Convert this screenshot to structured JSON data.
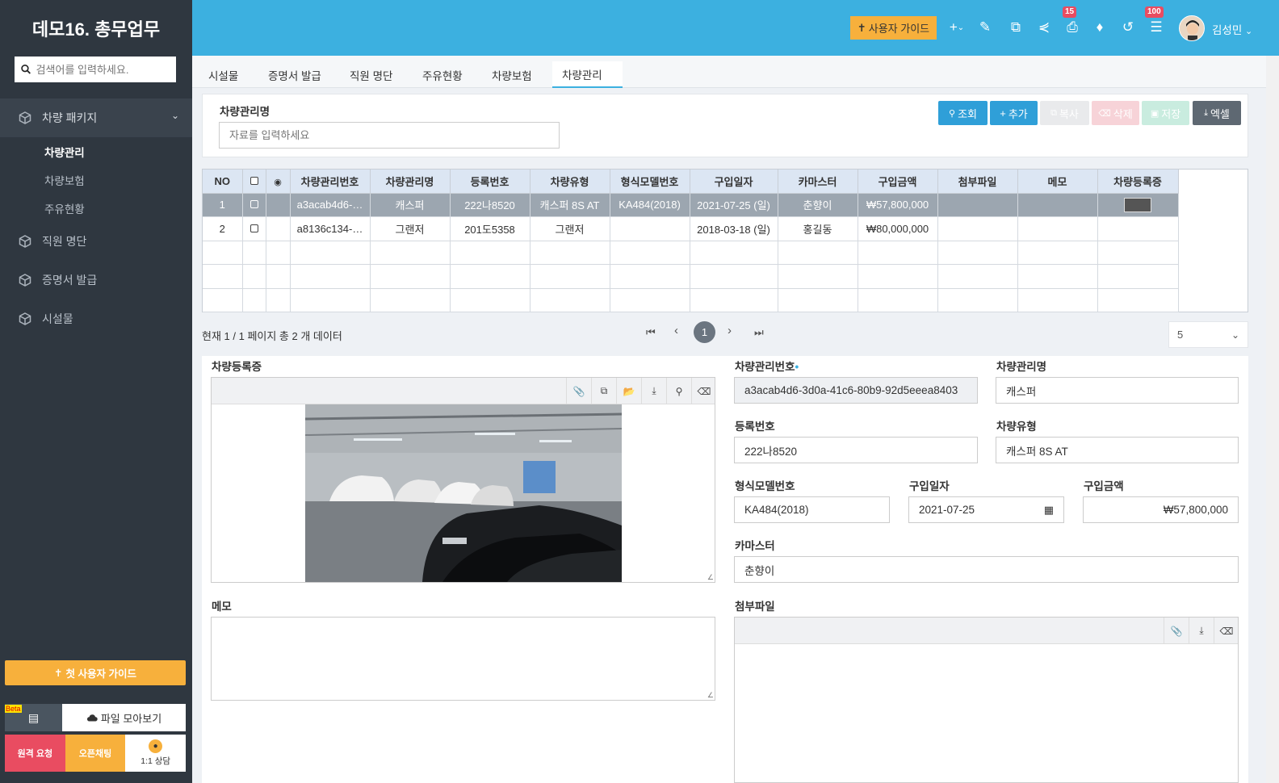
{
  "sidebar": {
    "brand": "데모16. 총무업무",
    "search_placeholder": "검색어를 입력하세요.",
    "groups": [
      {
        "label": "차량 패키지"
      },
      {
        "label": "직원 명단"
      },
      {
        "label": "증명서 발급"
      },
      {
        "label": "시설물"
      }
    ],
    "subitems": [
      "차량관리",
      "차량보험",
      "주유현황"
    ],
    "guide_label": "첫 사용자 가이드",
    "beta": "Beta",
    "files_label": "파일 모아보기",
    "remote_label": "원격 요청",
    "openchat_label": "오픈채팅",
    "consult_label": "1:1 상담"
  },
  "header": {
    "guide_label": "사용자 가이드",
    "share_badge": "15",
    "list_badge": "100",
    "user_name": "김성민"
  },
  "tabs": [
    "시설물",
    "증명서 발급",
    "직원 명단",
    "주유현황",
    "차량보험",
    "차량관리"
  ],
  "search": {
    "label": "차량관리명",
    "placeholder": "자료를 입력하세요",
    "buttons": {
      "query": "조회",
      "add": "추가",
      "copy": "복사",
      "delete": "삭제",
      "save": "저장",
      "excel": "엑셀"
    }
  },
  "grid": {
    "columns": [
      "NO",
      "",
      "",
      "차량관리번호",
      "차량관리명",
      "등록번호",
      "차량유형",
      "형식모델번호",
      "구입일자",
      "카마스터",
      "구입금액",
      "첨부파일",
      "메모",
      "차량등록증"
    ],
    "rows": [
      [
        "1",
        "",
        "",
        "a3acab4d6-…",
        "캐스퍼",
        "222나8520",
        "캐스퍼 8S AT",
        "KA484(2018)",
        "2021-07-25 (일)",
        "춘향이",
        "₩57,800,000",
        "",
        "",
        ""
      ],
      [
        "2",
        "",
        "",
        "a8136c134-…",
        "그랜저",
        "201도5358",
        "그랜저",
        "",
        "2018-03-18 (일)",
        "홍길동",
        "₩80,000,000",
        "",
        "",
        ""
      ]
    ]
  },
  "pager": {
    "info": "현재 1 / 1 페이지 총 2 개 데이터",
    "current": "1",
    "page_size": "5"
  },
  "detail": {
    "reg_cert_label": "차량등록증",
    "id_label": "차량관리번호",
    "id_value": "a3acab4d6-3d0a-41c6-80b9-92d5eeea8403",
    "name_label": "차량관리명",
    "name_value": "캐스퍼",
    "plate_label": "등록번호",
    "plate_value": "222나8520",
    "type_label": "차량유형",
    "type_value": "캐스퍼 8S AT",
    "model_label": "형식모델번호",
    "model_value": "KA484(2018)",
    "date_label": "구입일자",
    "date_value": "2021-07-25",
    "price_label": "구입금액",
    "price_value": "₩57,800,000",
    "master_label": "카마스터",
    "master_value": "춘향이",
    "memo_label": "메모",
    "attach_label": "첨부파일"
  },
  "colors": {
    "header": "#3cb0e0",
    "sidebar": "#2f3740",
    "accent_orange": "#f7b03c",
    "selected_row": "#9ca6b0"
  }
}
